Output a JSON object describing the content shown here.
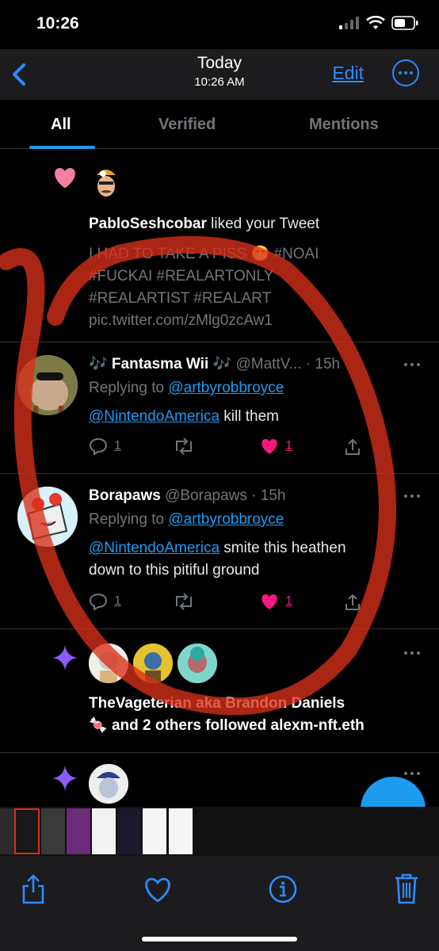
{
  "status_bar": {
    "time": "10:26"
  },
  "nav": {
    "title": "Today",
    "subtitle": "10:26 AM",
    "edit_label": "Edit"
  },
  "tabs": [
    {
      "label": "All"
    },
    {
      "label": "Verified"
    },
    {
      "label": "Mentions"
    }
  ],
  "like_notification": {
    "user": "PabloSeshcobar",
    "action_text": " liked your Tweet",
    "tweet_text_line1": "I HAD TO TAKE A PISS 😁 #NOAI",
    "tweet_text_line2": "#FUCKAI #REALARTONLY",
    "tweet_text_line3": "#REALARTIST #REALART",
    "tweet_text_line4": "pic.twitter.com/zMlg0zcAw1"
  },
  "reply1": {
    "name": "🎶 Fantasma Wii 🎶",
    "handle": "@MattV...",
    "time": "· 15h",
    "replying_prefix": "Replying to ",
    "replying_to": "@artbyrobbroyce",
    "mention": "@NintendoAmerica",
    "body": " kill them",
    "reply_count": "1",
    "like_count": "1"
  },
  "reply2": {
    "name": "Borapaws",
    "handle": "@Borapaws",
    "time": "· 15h",
    "replying_prefix": "Replying to ",
    "replying_to": "@artbyrobbroyce",
    "mention": "@NintendoAmerica",
    "body_line1": " smite this heathen",
    "body_line2": "down to this pitiful ground",
    "reply_count": "1",
    "like_count": "1"
  },
  "follow_notification": {
    "line1": "TheVageterian aka Brandon Daniels",
    "line2_emoji": "🍬",
    "line2_text": " and 2 others followed ",
    "line2_target": "alexm-nft.eth"
  },
  "colors": {
    "accent": "#1d9bf0",
    "like": "#f91880",
    "ink": "#d9301a"
  }
}
